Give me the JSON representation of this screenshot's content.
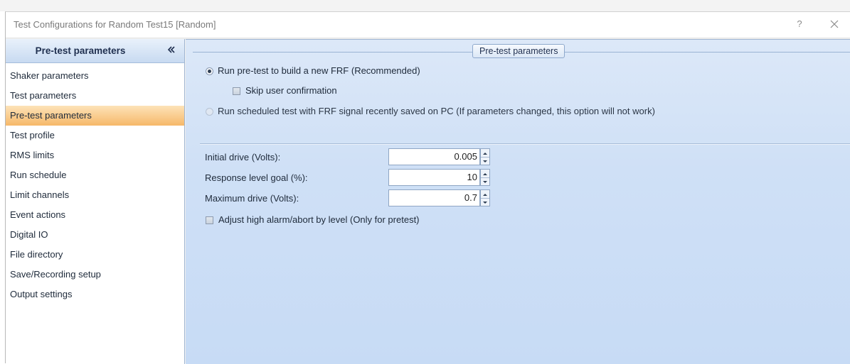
{
  "window": {
    "title": "Test Configurations for Random Test15 [Random]",
    "help_label": "?",
    "close_icon": "close-icon"
  },
  "sidebar": {
    "title": "Pre-test parameters",
    "collapse_icon": "double-chevron-left-icon",
    "items": [
      {
        "label": "Shaker parameters",
        "selected": false
      },
      {
        "label": "Test parameters",
        "selected": false
      },
      {
        "label": "Pre-test parameters",
        "selected": true
      },
      {
        "label": "Test profile",
        "selected": false
      },
      {
        "label": "RMS limits",
        "selected": false
      },
      {
        "label": "Run schedule",
        "selected": false
      },
      {
        "label": "Limit channels",
        "selected": false
      },
      {
        "label": "Event actions",
        "selected": false
      },
      {
        "label": "Digital IO",
        "selected": false
      },
      {
        "label": "File directory",
        "selected": false
      },
      {
        "label": "Save/Recording setup",
        "selected": false
      },
      {
        "label": "Output settings",
        "selected": false
      }
    ]
  },
  "main": {
    "group_title": "Pre-test parameters",
    "radio_new_frf": {
      "label": "Run pre-test to build a new FRF (Recommended)",
      "checked": true
    },
    "skip_confirm": {
      "label": "Skip user confirmation",
      "checked": false
    },
    "radio_scheduled": {
      "label": "Run scheduled test with FRF signal recently saved on PC (If parameters changed, this option will not work)",
      "checked": false,
      "enabled": false
    },
    "fields": {
      "initial_drive": {
        "label": "Initial drive (Volts):",
        "value": "0.005"
      },
      "response_goal": {
        "label": "Response level goal (%):",
        "value": "10"
      },
      "max_drive": {
        "label": "Maximum drive (Volts):",
        "value": "0.7"
      }
    },
    "adjust_alarm": {
      "label": "Adjust high alarm/abort by level (Only for pretest)",
      "checked": false
    }
  },
  "colors": {
    "selection_gradient_top": "#fde3b8",
    "selection_gradient_bottom": "#f6b869",
    "pane_background": "#cfe0f6",
    "header_background": "#c8daf1"
  }
}
